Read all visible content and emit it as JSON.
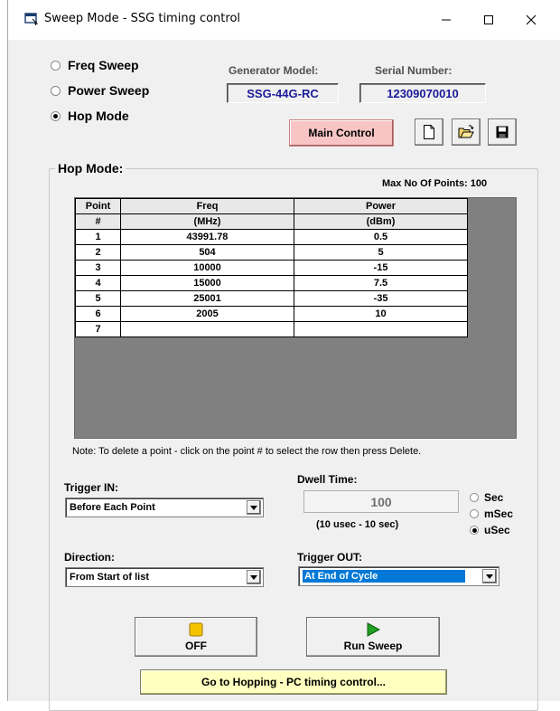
{
  "window": {
    "title": "Sweep Mode - SSG timing control"
  },
  "modes": [
    {
      "label": "Freq Sweep",
      "selected": false
    },
    {
      "label": "Power Sweep",
      "selected": false
    },
    {
      "label": "Hop Mode",
      "selected": true
    }
  ],
  "generator": {
    "model_label": "Generator Model:",
    "model_value": "SSG-44G-RC",
    "serial_label": "Serial Number:",
    "serial_value": "12309070010"
  },
  "toolbar": {
    "main_control_label": "Main Control",
    "new_icon": "new-document-icon",
    "open_icon": "open-folder-icon",
    "save_icon": "save-disk-icon"
  },
  "hop": {
    "group_title": "Hop Mode:",
    "max_points": "Max No Of Points: 100",
    "columns": [
      {
        "header": "Point",
        "sub": "#"
      },
      {
        "header": "Freq",
        "sub": "(MHz)"
      },
      {
        "header": "Power",
        "sub": "(dBm)"
      }
    ],
    "rows": [
      {
        "point": "1",
        "freq": "43991.78",
        "power": "0.5"
      },
      {
        "point": "2",
        "freq": "504",
        "power": "5"
      },
      {
        "point": "3",
        "freq": "10000",
        "power": "-15"
      },
      {
        "point": "4",
        "freq": "15000",
        "power": "7.5"
      },
      {
        "point": "5",
        "freq": "25001",
        "power": "-35"
      },
      {
        "point": "6",
        "freq": "2005",
        "power": "10"
      },
      {
        "point": "7",
        "freq": "",
        "power": ""
      }
    ],
    "note": "Note: To delete a point - click on the point # to select the row then press Delete."
  },
  "trigger_in": {
    "label": "Trigger IN:",
    "value": "Before Each Point"
  },
  "dwell": {
    "label": "Dwell Time:",
    "value": "100",
    "range": "(10 usec - 10 sec)",
    "units": [
      {
        "label": "Sec",
        "selected": false
      },
      {
        "label": "mSec",
        "selected": false
      },
      {
        "label": "uSec",
        "selected": true
      }
    ]
  },
  "direction": {
    "label": "Direction:",
    "value": "From Start of list"
  },
  "trigger_out": {
    "label": "Trigger OUT:",
    "value": "At End of Cycle"
  },
  "buttons": {
    "off_label": "OFF",
    "run_label": "Run Sweep",
    "goto_label": "Go to Hopping - PC timing control..."
  },
  "colors": {
    "main_control_bg": "#f8c4c4",
    "goto_bg": "#ffffc0",
    "off_icon": "#f5c400",
    "run_icon": "#22a022",
    "selection": "#0078d7",
    "value_text": "#1a1a9a"
  }
}
